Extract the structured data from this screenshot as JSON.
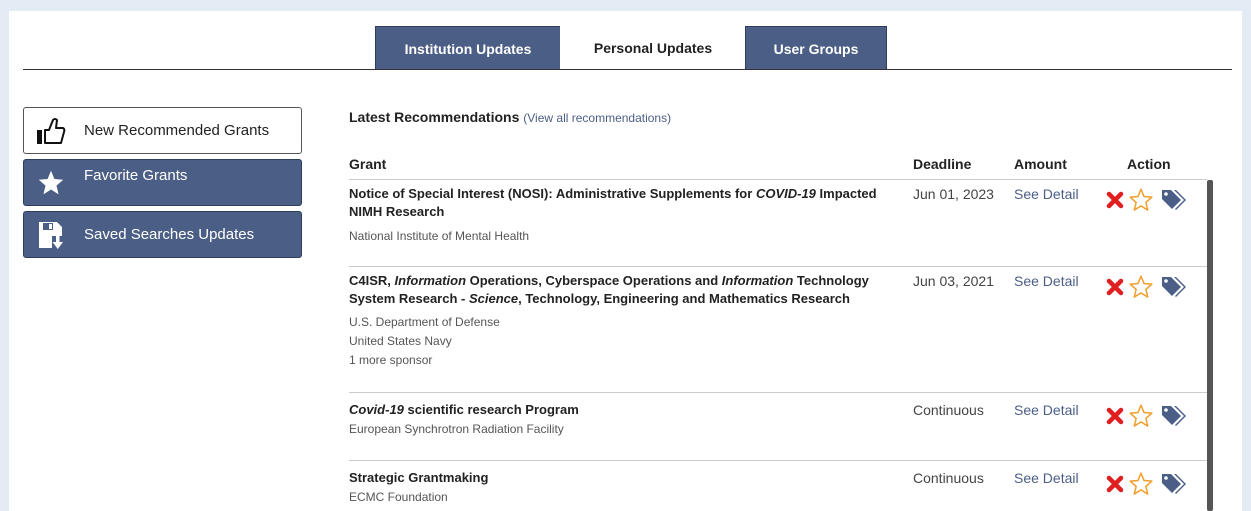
{
  "tabs": [
    {
      "label": "Institution Updates",
      "active": false
    },
    {
      "label": "Personal Updates",
      "active": true
    },
    {
      "label": "User Groups",
      "active": false
    }
  ],
  "sidebar": {
    "items": [
      {
        "label": "New Recommended Grants",
        "icon": "thumbs-up-icon"
      },
      {
        "label": "Favorite Grants",
        "icon": "star-icon"
      },
      {
        "label": "Saved Searches Updates",
        "icon": "saved-search-icon"
      }
    ]
  },
  "main": {
    "heading": "Latest Recommendations",
    "view_all": "(View all recommendations)",
    "columns": [
      "Grant",
      "Deadline",
      "Amount",
      "Action"
    ],
    "detail_label": "See Detail",
    "rows": [
      {
        "title_parts": [
          {
            "t": "Notice of Special Interest (NOSI): Administrative Supplements for ",
            "i": false
          },
          {
            "t": "COVID-19",
            "i": true
          },
          {
            "t": " Impacted NIMH Research",
            "i": false
          }
        ],
        "sponsors": [
          "National Institute of Mental Health"
        ],
        "deadline": "Jun 01, 2023"
      },
      {
        "title_parts": [
          {
            "t": "C4ISR, ",
            "i": false
          },
          {
            "t": "Information",
            "i": true
          },
          {
            "t": " Operations, Cyberspace Operations and ",
            "i": false
          },
          {
            "t": "Information",
            "i": true
          },
          {
            "t": " Technology System Research - ",
            "i": false
          },
          {
            "t": "Science",
            "i": true
          },
          {
            "t": ", Technology, Engineering and Mathematics Research",
            "i": false
          }
        ],
        "sponsors": [
          "U.S. Department of Defense",
          "United States Navy",
          "1 more sponsor"
        ],
        "deadline": "Jun 03, 2021"
      },
      {
        "title_parts": [
          {
            "t": "Covid-19",
            "i": true
          },
          {
            "t": " scientific research Program",
            "i": false
          }
        ],
        "sponsors": [
          "European Synchrotron Radiation Facility"
        ],
        "deadline": "Continuous"
      },
      {
        "title_parts": [
          {
            "t": "Strategic Grantmaking",
            "i": false
          }
        ],
        "sponsors": [
          "ECMC Foundation"
        ],
        "deadline": "Continuous"
      }
    ]
  },
  "icons": {
    "remove": "close-icon",
    "favorite": "star-outline-icon",
    "tag": "tags-icon"
  },
  "colors": {
    "primary": "#4b5e85",
    "page_bg": "#e3ecf5",
    "remove": "#e02020",
    "star": "#f0a030",
    "tag": "#4b5e85"
  }
}
